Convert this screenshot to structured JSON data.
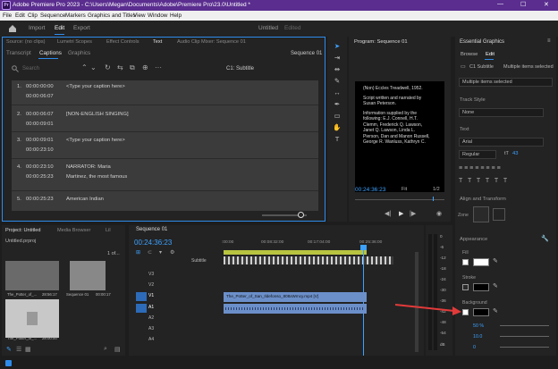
{
  "titlebar": {
    "title": "Adobe Premiere Pro 2023 - C:\\Users\\Megan\\Documents\\Adobe\\Premiere Pro\\23.0\\Untitled *",
    "logo": "Pr",
    "min": "—",
    "max": "☐",
    "close": "✕"
  },
  "menu": [
    "File",
    "Edit",
    "Clip",
    "Sequence",
    "Markers",
    "Graphics and Titles",
    "View",
    "Window",
    "Help"
  ],
  "workspace": {
    "home_icon": "home-icon",
    "import": "Import",
    "edit": "Edit",
    "export": "Export",
    "project": "Untitled",
    "status": "Edited"
  },
  "top_left_tabs": [
    "Source: (no clips)",
    "Lumetri Scopes",
    "Effect Controls",
    "Text",
    "Audio Clip Mixer: Sequence 01"
  ],
  "text_panel": {
    "subtabs": [
      "Transcript",
      "Captions",
      "Graphics"
    ],
    "sequence": "Sequence 01",
    "search_placeholder": "Search",
    "track": "C1: Subtitle",
    "captions": [
      {
        "n": "1.",
        "in": "00:00:00:00",
        "out": "00:00:06:07",
        "text": "<Type your caption here>"
      },
      {
        "n": "2.",
        "in": "00:00:06:07",
        "out": "00:00:09:01",
        "text": "[NON-ENGLISH SINGING]"
      },
      {
        "n": "3.",
        "in": "00:00:09:01",
        "out": "00:00:23:10",
        "text": "<Type your caption here>"
      },
      {
        "n": "4.",
        "in": "00:00:23:10",
        "out": "00:00:25:23",
        "text": "NARRATOR: Maria",
        "text2": "Martinez, the most famous"
      },
      {
        "n": "5.",
        "in": "00:00:25:23",
        "out": "",
        "text": "American Indian"
      }
    ]
  },
  "program": {
    "title": "Program: Sequence 01",
    "credits": [
      "(Non) Eccles Treadwell, 1952.",
      "",
      "Script written and narrated by",
      "Susan Peterson.",
      "",
      "Information supplied by the",
      "following: E.J. Connell, H.T.",
      "Clemm, Frederick Q. Lawson,",
      "Janet Q. Lawson, Linda L.",
      "Pierson, Dan and Manon Russell,",
      "George R. Wanluss, Kathryn C."
    ],
    "timecode": "00:24:36:23",
    "fit": "Fit",
    "fraction": "1/2"
  },
  "project_panel": {
    "tabs": [
      "Project: Untitled",
      "Media Browser",
      "Lil"
    ],
    "file": "Untitled.prproj",
    "count": "1 of...",
    "items": [
      {
        "name": "The_Potter_of_...",
        "dur": "28:56:17"
      },
      {
        "name": "Sequence 01",
        "dur": "00:00:17"
      },
      {
        "name": "The_Potter_of_...",
        "dur": "28:00:00"
      }
    ]
  },
  "timeline": {
    "title": "Sequence 01",
    "timecode": "00:24:36:23",
    "ruler": [
      ":00:00",
      "00:08:32:00",
      "00:17:04:00",
      "00:25:36:00"
    ],
    "subtitle_track": "Subtitle",
    "clip_name": "The_Potter_of_San_Ildefonso_808xWmcy.mp4 [V]",
    "video_tracks": [
      "V3",
      "V2",
      "V1"
    ],
    "audio_tracks": [
      "A1",
      "A2",
      "A3",
      "A4"
    ]
  },
  "meters": [
    "0",
    "-6",
    "-12",
    "-18",
    "-24",
    "-30",
    "-36",
    "-42",
    "-48",
    "-54",
    "dB"
  ],
  "essential_graphics": {
    "title": "Essential Graphics",
    "tabs": [
      "Browse",
      "Edit"
    ],
    "layer": "C1 Subtitle",
    "multi": "Multiple items selected",
    "selected": "Multiple items selected",
    "track_style_label": "Track Style",
    "track_style": "None",
    "text_label": "Text",
    "font": "Arial",
    "weight": "Regular",
    "size": "43",
    "align_label": "Align and Transform",
    "zone_label": "Zone",
    "appearance_label": "Appearance",
    "fill_label": "Fill",
    "stroke_label": "Stroke",
    "background_label": "Background",
    "bg_opacity": "50 %",
    "bg_size": "10.0",
    "bg_corner": "0",
    "fill_color": "#ffffff",
    "stroke_color": "#000000",
    "bg_color": "#000000"
  },
  "colors": {
    "accent": "#2d8ceb",
    "titlebar": "#5a2d8f",
    "clip": "#6b8fc9",
    "playhead": "#3da2ff",
    "arrow": "#e23a3a"
  }
}
